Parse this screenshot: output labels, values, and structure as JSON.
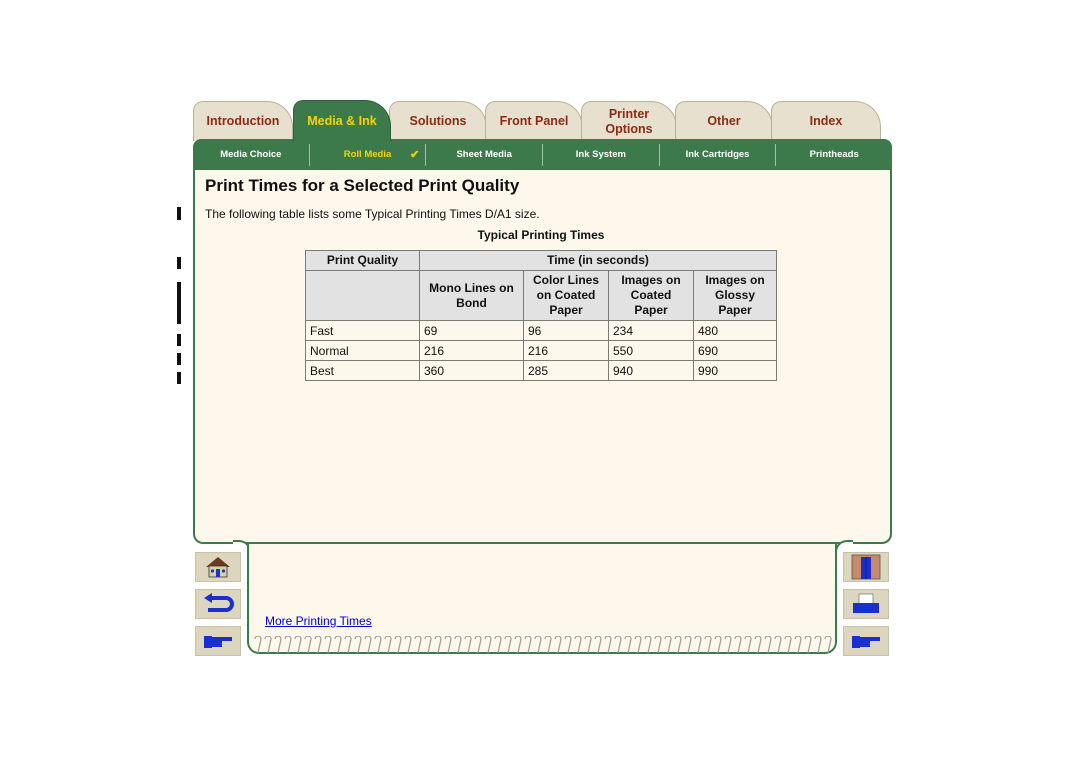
{
  "tabs": [
    {
      "label": "Introduction",
      "active": false
    },
    {
      "label": "Media & Ink",
      "active": true
    },
    {
      "label": "Solutions",
      "active": false
    },
    {
      "label": "Front Panel",
      "active": false
    },
    {
      "label": "Printer Options",
      "active": false
    },
    {
      "label": "Other",
      "active": false
    },
    {
      "label": "Index",
      "active": false
    }
  ],
  "subnav": [
    {
      "label": "Media Choice"
    },
    {
      "label": "Roll Media",
      "active": true,
      "check": "✔"
    },
    {
      "label": "Sheet Media"
    },
    {
      "label": "Ink System"
    },
    {
      "label": "Ink Cartridges"
    },
    {
      "label": "Printheads"
    }
  ],
  "page": {
    "title": "Print Times for a Selected Print Quality",
    "intro": "The following table lists some Typical Printing Times D/A1 size.",
    "caption": "Typical Printing Times"
  },
  "table": {
    "header_quality": "Print Quality",
    "header_time": "Time (in seconds)",
    "columns": [
      "Mono Lines on Bond",
      "Color Lines on Coated Paper",
      "Images on Coated Paper",
      "Images on Glossy Paper"
    ],
    "rows": [
      {
        "quality": "Fast",
        "values": [
          "69",
          "96",
          "234",
          "480"
        ]
      },
      {
        "quality": "Normal",
        "values": [
          "216",
          "216",
          "550",
          "690"
        ]
      },
      {
        "quality": "Best",
        "values": [
          "360",
          "285",
          "940",
          "990"
        ]
      }
    ]
  },
  "footer": {
    "link": "More Printing Times",
    "left_buttons": [
      "home-icon",
      "back-icon",
      "next-page-icon"
    ],
    "right_buttons": [
      "exit-door-icon",
      "print-icon",
      "next-page-icon"
    ]
  }
}
